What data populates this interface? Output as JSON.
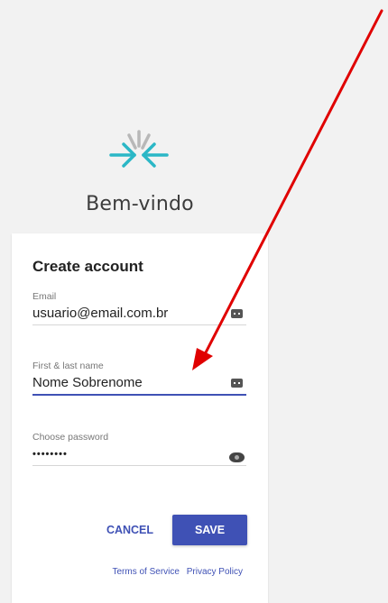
{
  "brand": {
    "logo_icon": "asterisk-arrows-logo-icon",
    "logo_colors": [
      "#b8b8b8",
      "#2bb7c6"
    ]
  },
  "welcome_text": "Bem-vindo",
  "form": {
    "title": "Create account",
    "fields": [
      {
        "label": "Email",
        "value": "usuario@email.com.br",
        "icon": "autofill-key-icon"
      },
      {
        "label": "First & last name",
        "value": "Nome Sobrenome",
        "icon": "autofill-key-icon",
        "focused": true
      },
      {
        "label": "Choose password",
        "value": "••••••••",
        "icon": "show-password-eye-icon"
      }
    ],
    "cancel_label": "CANCEL",
    "save_label": "SAVE"
  },
  "footer": {
    "terms_label": "Terms of Service",
    "privacy_label": "Privacy Policy"
  },
  "annotation": {
    "type": "arrow",
    "color": "#e00000"
  },
  "colors": {
    "accent": "#3f51b5",
    "background": "#f2f2f2",
    "card": "#ffffff"
  }
}
